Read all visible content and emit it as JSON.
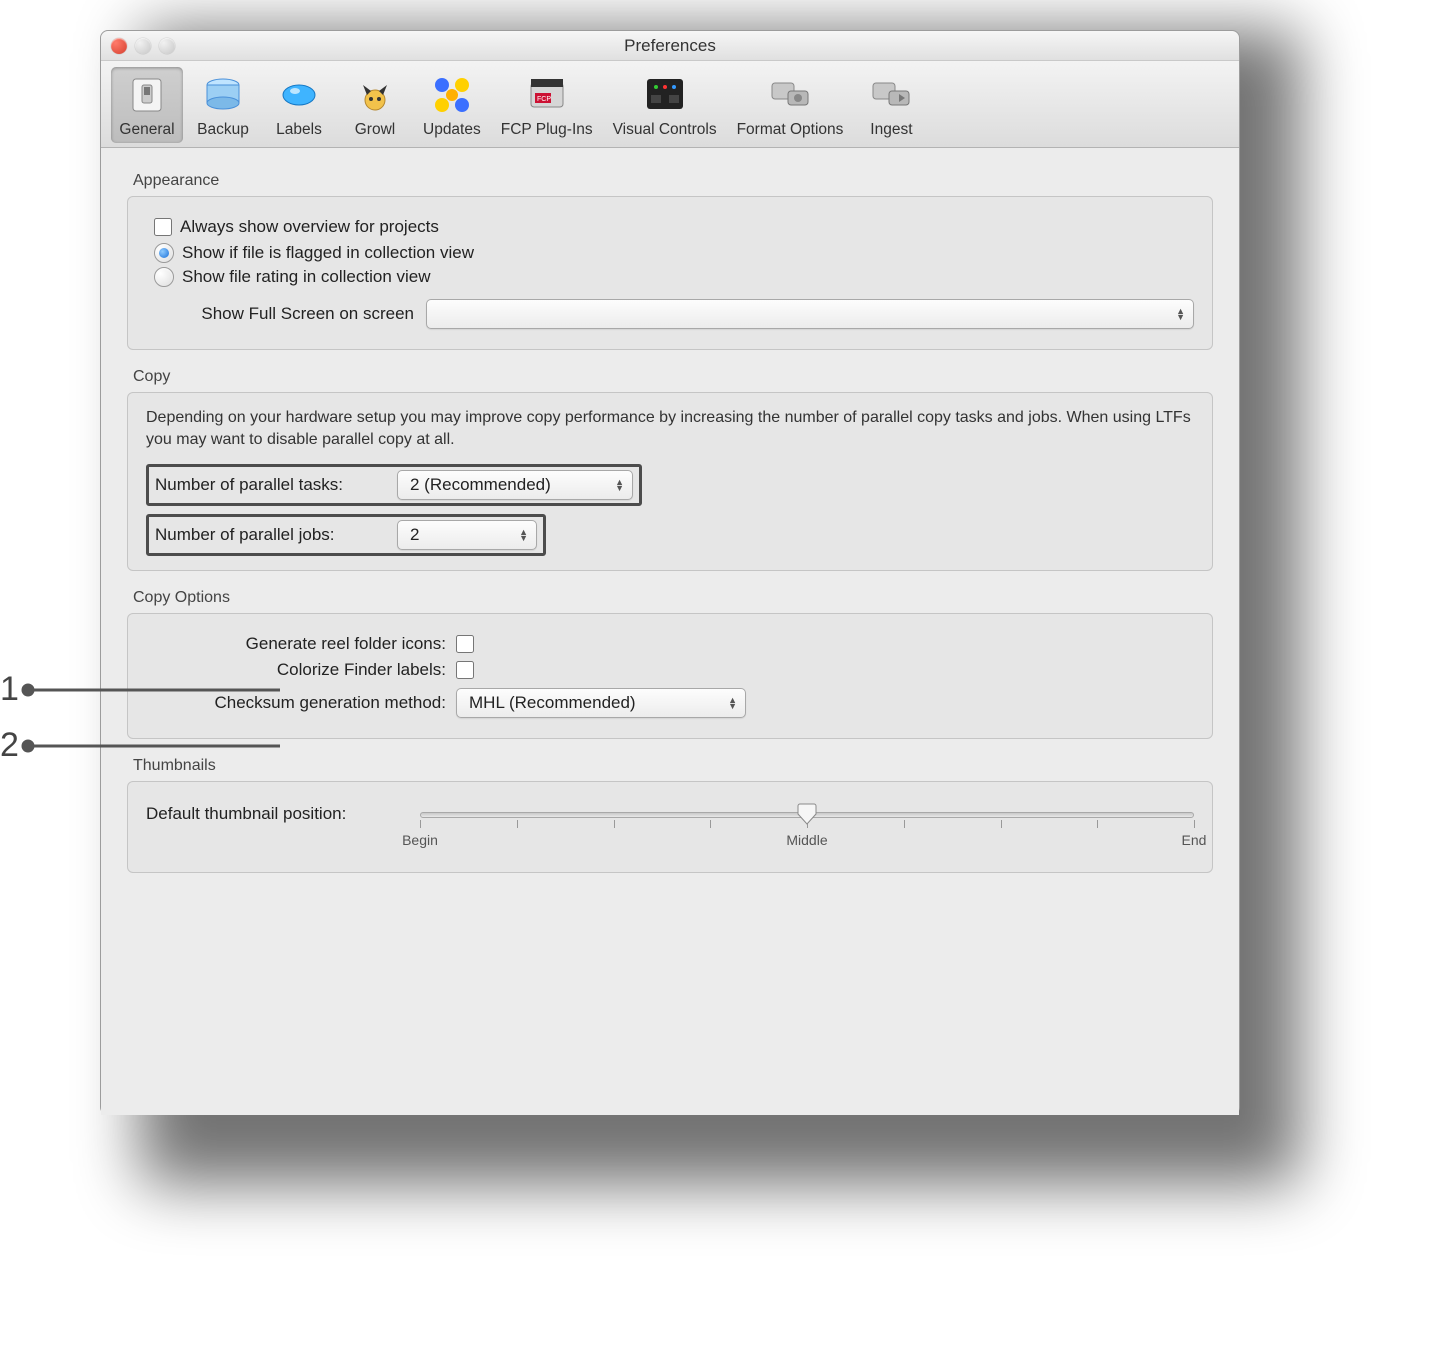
{
  "window": {
    "title": "Preferences"
  },
  "toolbar": {
    "items": [
      {
        "label": "General",
        "iconName": "general-icon",
        "selected": true
      },
      {
        "label": "Backup",
        "iconName": "backup-icon"
      },
      {
        "label": "Labels",
        "iconName": "labels-icon"
      },
      {
        "label": "Growl",
        "iconName": "growl-icon"
      },
      {
        "label": "Updates",
        "iconName": "updates-icon"
      },
      {
        "label": "FCP Plug-Ins",
        "iconName": "fcp-icon"
      },
      {
        "label": "Visual Controls",
        "iconName": "visual-controls-icon"
      },
      {
        "label": "Format Options",
        "iconName": "format-options-icon"
      },
      {
        "label": "Ingest",
        "iconName": "ingest-icon"
      }
    ]
  },
  "appearance": {
    "title": "Appearance",
    "always_overview": {
      "label": "Always show overview for projects",
      "checked": false
    },
    "radio_selected": "flagged",
    "radio_flagged_label": "Show if file is flagged in collection view",
    "radio_rating_label": "Show file rating in collection view",
    "fullscreen_label": "Show Full Screen on screen",
    "fullscreen_value": ""
  },
  "copy": {
    "title": "Copy",
    "description": "Depending on your hardware setup you may improve copy performance by increasing the number of parallel copy tasks and jobs. When using LTFs you may want to disable parallel copy at all.",
    "tasks_label": "Number of parallel tasks:",
    "tasks_value": "2 (Recommended)",
    "jobs_label": "Number of parallel jobs:",
    "jobs_value": "2"
  },
  "copy_options": {
    "title": "Copy Options",
    "reel_label": "Generate reel folder icons:",
    "reel_checked": false,
    "finder_label": "Colorize Finder labels:",
    "finder_checked": false,
    "checksum_label": "Checksum generation method:",
    "checksum_value": "MHL (Recommended)"
  },
  "thumbnails": {
    "title": "Thumbnails",
    "label": "Default thumbnail position:",
    "ticks": [
      "Begin",
      "",
      "",
      "",
      "Middle",
      "",
      "",
      "",
      "End"
    ],
    "value_index": 4
  },
  "callouts": {
    "one": "1",
    "two": "2"
  }
}
